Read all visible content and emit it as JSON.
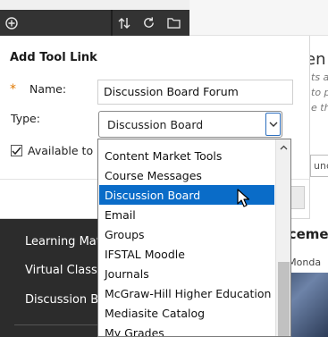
{
  "toolbar": {
    "icons": [
      "add-icon",
      "sort-arrows-icon",
      "refresh-icon",
      "folder-icon"
    ]
  },
  "nav": {
    "items": [
      "Learning Mate",
      "Virtual Classro",
      "Discussion Bo"
    ]
  },
  "background": {
    "heading_fragment": "en",
    "italic_fragments": [
      "ts a",
      "to p",
      "e th"
    ],
    "button_fragment": "unc",
    "announcement_fragment": "ncement",
    "posted_on_fragment": "n: Monda"
  },
  "modal": {
    "title": "Add Tool Link",
    "required_marker": "*",
    "name_label": "Name:",
    "name_value": "Discussion Board Forum",
    "type_label": "Type:",
    "type_value": "Discussion Board",
    "available_label": "Available to U",
    "available_checked": true
  },
  "dropdown": {
    "selected": "Discussion Board",
    "options": [
      "Content Market Tools",
      "Course Messages",
      "Discussion Board",
      "Email",
      "Groups",
      "IFSTAL Moodle",
      "Journals",
      "McGraw-Hill Higher Education",
      "Mediasite Catalog",
      "My Grades"
    ]
  },
  "colors": {
    "selection": "#0a6cc8",
    "required": "#e07800",
    "nav_bg": "#2c2c2c"
  }
}
